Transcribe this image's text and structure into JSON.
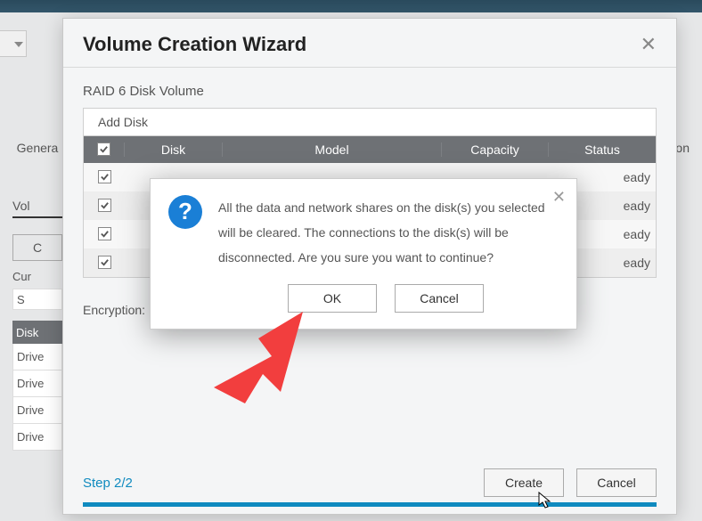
{
  "background": {
    "left_label": "Genera",
    "tab_label": "Vol",
    "box_label": "C",
    "cur_label": "Cur",
    "s_label": "S",
    "disk_header": "Disk",
    "drive_rows": [
      "Drive",
      "Drive",
      "Drive",
      "Drive"
    ],
    "right_label": "ation"
  },
  "wizard": {
    "title": "Volume Creation Wizard",
    "volume_name": "RAID 6 Disk Volume",
    "add_disk_label": "Add Disk",
    "columns": {
      "disk": "Disk",
      "model": "Model",
      "capacity": "Capacity",
      "status": "Status"
    },
    "rows": [
      {
        "checked": true,
        "status": "eady"
      },
      {
        "checked": true,
        "status": "eady"
      },
      {
        "checked": true,
        "status": "eady"
      },
      {
        "checked": true,
        "status": "eady"
      }
    ],
    "header_checked": true,
    "encryption_label": "Encryption:",
    "step_label": "Step 2/2",
    "create_label": "Create",
    "cancel_label": "Cancel"
  },
  "confirm": {
    "message": "All the data and network shares on the disk(s) you selected will be cleared. The connections to the disk(s) will be disconnected. Are you sure you want to continue?",
    "ok_label": "OK",
    "cancel_label": "Cancel"
  }
}
